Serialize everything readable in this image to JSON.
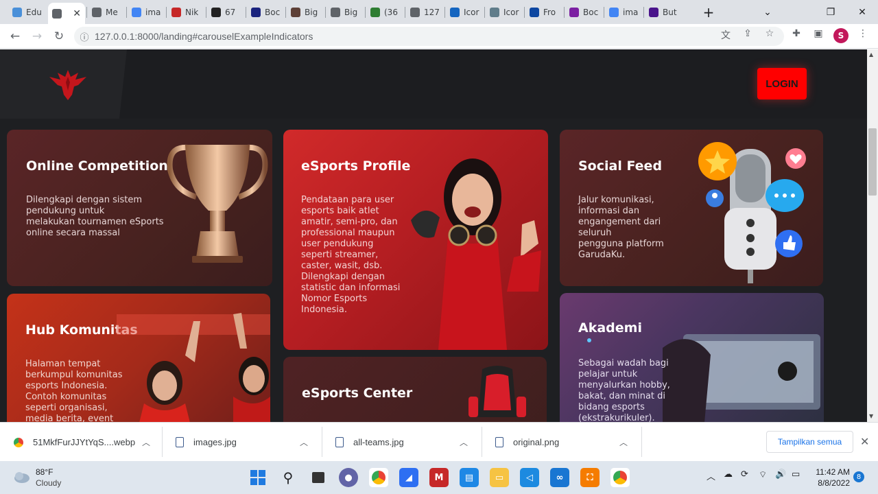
{
  "browser": {
    "tabs": [
      {
        "label": "Edu",
        "color": "#4a90d9"
      },
      {
        "label": "",
        "color": "#5f6368",
        "active": true
      },
      {
        "label": "Me",
        "color": "#5f6368"
      },
      {
        "label": "ima",
        "color": "#4285f4"
      },
      {
        "label": "Nik",
        "color": "#c62828"
      },
      {
        "label": "67",
        "color": "#222222"
      },
      {
        "label": "Boc",
        "color": "#1a237e"
      },
      {
        "label": "Big",
        "color": "#5d4037"
      },
      {
        "label": "Big",
        "color": "#5f6368"
      },
      {
        "label": "(36",
        "color": "#2e7d32"
      },
      {
        "label": "127",
        "color": "#5f6368"
      },
      {
        "label": "Icor",
        "color": "#1565c0"
      },
      {
        "label": "Icor",
        "color": "#607d8b"
      },
      {
        "label": "Fro",
        "color": "#0d47a1"
      },
      {
        "label": "Boc",
        "color": "#7b1fa2"
      },
      {
        "label": "ima",
        "color": "#4285f4"
      },
      {
        "label": "But",
        "color": "#4a148c"
      }
    ],
    "url": "127.0.0.1:8000/landing#carouselExampleIndicators",
    "profile_initial": "S"
  },
  "site": {
    "login_label": "LOGIN",
    "brand_color": "#ff0000"
  },
  "cards": {
    "online": {
      "title": "Online Competition",
      "desc": "Dilengkapi dengan sistem\npendukung untuk\nmelakukan tournamen eSports\nonline secara massal"
    },
    "profile": {
      "title": "eSports Profile",
      "desc": "Pendataan para user\nesports baik atlet\namatir, semi-pro, dan\nprofessional maupun\nuser pendukung\nseperti streamer,\ncaster, wasit, dsb.\nDilengkapi dengan\nstatistic dan informasi\nNomor Esports\nIndonesia."
    },
    "social": {
      "title": "Social Feed",
      "desc": "Jalur komunikasi,\ninformasi dan\nengangement dari\nseluruh\npengguna platform\nGarudaKu."
    },
    "hub": {
      "title": "Hub Komunitas",
      "desc": "Halaman tempat\nberkumpul komunitas\nesports Indonesia.\nContoh komunitas\nseperti organisasi,\nmedia berita, event"
    },
    "center": {
      "title": "eSports Center"
    },
    "akademi": {
      "title": "Akademi",
      "desc": "Sebagai wadah bagi\npelajar untuk\nmenyalurkan hobby,\nbakat, dan minat di\nbidang esports\n(ekstrakurikuler)."
    }
  },
  "downloads": {
    "items": [
      "51MkfFurJJYtYqS....webp",
      "images.jpg",
      "all-teams.jpg",
      "original.png"
    ],
    "show_all_label": "Tampilkan semua"
  },
  "taskbar": {
    "weather_temp": "88°F",
    "weather_desc": "Cloudy",
    "time": "11:42 AM",
    "date": "8/8/2022",
    "notification_count": "8"
  }
}
